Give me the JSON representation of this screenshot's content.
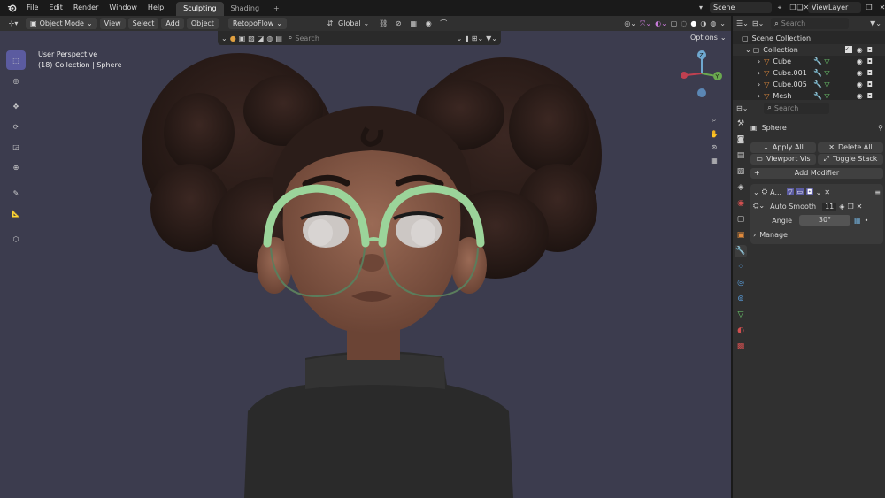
{
  "menu": [
    "File",
    "Edit",
    "Render",
    "Window",
    "Help"
  ],
  "workspaces": {
    "active": "Sculpting",
    "inactive": "Shading",
    "add": "+"
  },
  "scene": {
    "label": "Scene"
  },
  "viewlayer": {
    "label": "ViewLayer"
  },
  "header": {
    "mode": "Object Mode",
    "view": "View",
    "select": "Select",
    "add": "Add",
    "object": "Object",
    "addon": "RetopoFlow",
    "transform": "Global",
    "options": "Options"
  },
  "viewport": {
    "perspective": "User Perspective",
    "collection_info": "(18) Collection | Sphere",
    "search_placeholder": "Search",
    "colors": {
      "bg": "#3c3c4e",
      "skin": "#7e5442",
      "hair": "#2b1d19",
      "glasses": "#9bd49a",
      "sweater": "#2a2a2a"
    }
  },
  "outliner": {
    "search_placeholder": "Search",
    "root": "Scene Collection",
    "collection": "Collection",
    "items": [
      "Cube",
      "Cube.001",
      "Cube.005",
      "Mesh"
    ]
  },
  "properties": {
    "search_placeholder": "Search",
    "object": "Sphere",
    "apply_all": "Apply All",
    "delete_all": "Delete All",
    "viewport_vis": "Viewport Vis",
    "toggle_stack": "Toggle Stack",
    "add_modifier": "Add Modifier",
    "modifier_short": "A...",
    "auto_smooth": "Auto Smooth",
    "auto_smooth_num": "11",
    "angle_label": "Angle",
    "angle_value": "30°",
    "manage": "Manage"
  }
}
